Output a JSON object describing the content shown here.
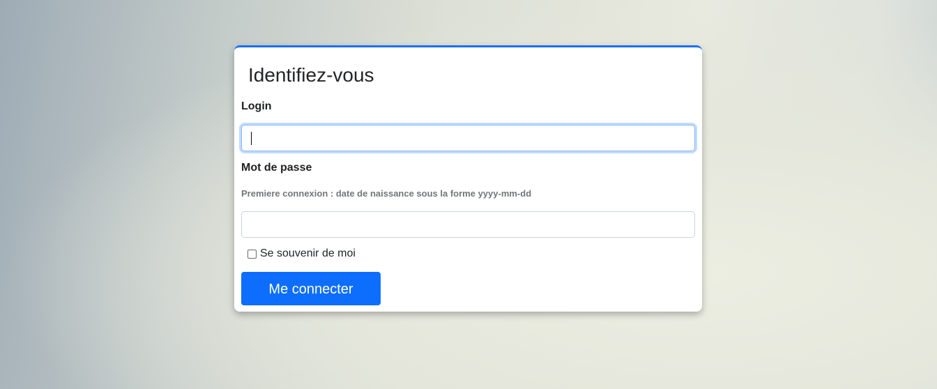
{
  "form": {
    "title": "Identifiez-vous",
    "login_label": "Login",
    "login_value": "",
    "password_label": "Mot de passe",
    "password_hint": "Premiere connexion : date de naissance sous la forme yyyy-mm-dd",
    "password_value": "",
    "remember_label": "Se souvenir de moi",
    "remember_checked": false,
    "submit_label": "Me connecter"
  },
  "colors": {
    "accent": "#0d6efd",
    "card_border_top": "#1a6ff5",
    "focus_ring": "#86b7fe",
    "hint_text": "#737678"
  }
}
